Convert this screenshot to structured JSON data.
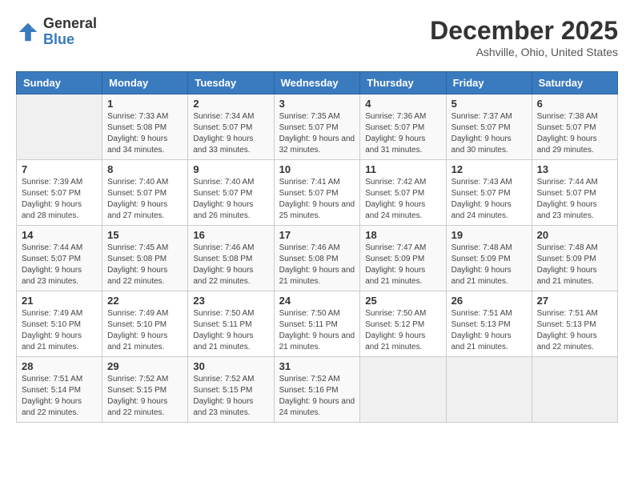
{
  "header": {
    "logo_general": "General",
    "logo_blue": "Blue",
    "month_title": "December 2025",
    "location": "Ashville, Ohio, United States"
  },
  "weekdays": [
    "Sunday",
    "Monday",
    "Tuesday",
    "Wednesday",
    "Thursday",
    "Friday",
    "Saturday"
  ],
  "weeks": [
    [
      {
        "day": "",
        "sunrise": "",
        "sunset": "",
        "daylight": ""
      },
      {
        "day": "1",
        "sunrise": "Sunrise: 7:33 AM",
        "sunset": "Sunset: 5:08 PM",
        "daylight": "Daylight: 9 hours and 34 minutes."
      },
      {
        "day": "2",
        "sunrise": "Sunrise: 7:34 AM",
        "sunset": "Sunset: 5:07 PM",
        "daylight": "Daylight: 9 hours and 33 minutes."
      },
      {
        "day": "3",
        "sunrise": "Sunrise: 7:35 AM",
        "sunset": "Sunset: 5:07 PM",
        "daylight": "Daylight: 9 hours and 32 minutes."
      },
      {
        "day": "4",
        "sunrise": "Sunrise: 7:36 AM",
        "sunset": "Sunset: 5:07 PM",
        "daylight": "Daylight: 9 hours and 31 minutes."
      },
      {
        "day": "5",
        "sunrise": "Sunrise: 7:37 AM",
        "sunset": "Sunset: 5:07 PM",
        "daylight": "Daylight: 9 hours and 30 minutes."
      },
      {
        "day": "6",
        "sunrise": "Sunrise: 7:38 AM",
        "sunset": "Sunset: 5:07 PM",
        "daylight": "Daylight: 9 hours and 29 minutes."
      }
    ],
    [
      {
        "day": "7",
        "sunrise": "Sunrise: 7:39 AM",
        "sunset": "Sunset: 5:07 PM",
        "daylight": "Daylight: 9 hours and 28 minutes."
      },
      {
        "day": "8",
        "sunrise": "Sunrise: 7:40 AM",
        "sunset": "Sunset: 5:07 PM",
        "daylight": "Daylight: 9 hours and 27 minutes."
      },
      {
        "day": "9",
        "sunrise": "Sunrise: 7:40 AM",
        "sunset": "Sunset: 5:07 PM",
        "daylight": "Daylight: 9 hours and 26 minutes."
      },
      {
        "day": "10",
        "sunrise": "Sunrise: 7:41 AM",
        "sunset": "Sunset: 5:07 PM",
        "daylight": "Daylight: 9 hours and 25 minutes."
      },
      {
        "day": "11",
        "sunrise": "Sunrise: 7:42 AM",
        "sunset": "Sunset: 5:07 PM",
        "daylight": "Daylight: 9 hours and 24 minutes."
      },
      {
        "day": "12",
        "sunrise": "Sunrise: 7:43 AM",
        "sunset": "Sunset: 5:07 PM",
        "daylight": "Daylight: 9 hours and 24 minutes."
      },
      {
        "day": "13",
        "sunrise": "Sunrise: 7:44 AM",
        "sunset": "Sunset: 5:07 PM",
        "daylight": "Daylight: 9 hours and 23 minutes."
      }
    ],
    [
      {
        "day": "14",
        "sunrise": "Sunrise: 7:44 AM",
        "sunset": "Sunset: 5:07 PM",
        "daylight": "Daylight: 9 hours and 23 minutes."
      },
      {
        "day": "15",
        "sunrise": "Sunrise: 7:45 AM",
        "sunset": "Sunset: 5:08 PM",
        "daylight": "Daylight: 9 hours and 22 minutes."
      },
      {
        "day": "16",
        "sunrise": "Sunrise: 7:46 AM",
        "sunset": "Sunset: 5:08 PM",
        "daylight": "Daylight: 9 hours and 22 minutes."
      },
      {
        "day": "17",
        "sunrise": "Sunrise: 7:46 AM",
        "sunset": "Sunset: 5:08 PM",
        "daylight": "Daylight: 9 hours and 21 minutes."
      },
      {
        "day": "18",
        "sunrise": "Sunrise: 7:47 AM",
        "sunset": "Sunset: 5:09 PM",
        "daylight": "Daylight: 9 hours and 21 minutes."
      },
      {
        "day": "19",
        "sunrise": "Sunrise: 7:48 AM",
        "sunset": "Sunset: 5:09 PM",
        "daylight": "Daylight: 9 hours and 21 minutes."
      },
      {
        "day": "20",
        "sunrise": "Sunrise: 7:48 AM",
        "sunset": "Sunset: 5:09 PM",
        "daylight": "Daylight: 9 hours and 21 minutes."
      }
    ],
    [
      {
        "day": "21",
        "sunrise": "Sunrise: 7:49 AM",
        "sunset": "Sunset: 5:10 PM",
        "daylight": "Daylight: 9 hours and 21 minutes."
      },
      {
        "day": "22",
        "sunrise": "Sunrise: 7:49 AM",
        "sunset": "Sunset: 5:10 PM",
        "daylight": "Daylight: 9 hours and 21 minutes."
      },
      {
        "day": "23",
        "sunrise": "Sunrise: 7:50 AM",
        "sunset": "Sunset: 5:11 PM",
        "daylight": "Daylight: 9 hours and 21 minutes."
      },
      {
        "day": "24",
        "sunrise": "Sunrise: 7:50 AM",
        "sunset": "Sunset: 5:11 PM",
        "daylight": "Daylight: 9 hours and 21 minutes."
      },
      {
        "day": "25",
        "sunrise": "Sunrise: 7:50 AM",
        "sunset": "Sunset: 5:12 PM",
        "daylight": "Daylight: 9 hours and 21 minutes."
      },
      {
        "day": "26",
        "sunrise": "Sunrise: 7:51 AM",
        "sunset": "Sunset: 5:13 PM",
        "daylight": "Daylight: 9 hours and 21 minutes."
      },
      {
        "day": "27",
        "sunrise": "Sunrise: 7:51 AM",
        "sunset": "Sunset: 5:13 PM",
        "daylight": "Daylight: 9 hours and 22 minutes."
      }
    ],
    [
      {
        "day": "28",
        "sunrise": "Sunrise: 7:51 AM",
        "sunset": "Sunset: 5:14 PM",
        "daylight": "Daylight: 9 hours and 22 minutes."
      },
      {
        "day": "29",
        "sunrise": "Sunrise: 7:52 AM",
        "sunset": "Sunset: 5:15 PM",
        "daylight": "Daylight: 9 hours and 22 minutes."
      },
      {
        "day": "30",
        "sunrise": "Sunrise: 7:52 AM",
        "sunset": "Sunset: 5:15 PM",
        "daylight": "Daylight: 9 hours and 23 minutes."
      },
      {
        "day": "31",
        "sunrise": "Sunrise: 7:52 AM",
        "sunset": "Sunset: 5:16 PM",
        "daylight": "Daylight: 9 hours and 24 minutes."
      },
      {
        "day": "",
        "sunrise": "",
        "sunset": "",
        "daylight": ""
      },
      {
        "day": "",
        "sunrise": "",
        "sunset": "",
        "daylight": ""
      },
      {
        "day": "",
        "sunrise": "",
        "sunset": "",
        "daylight": ""
      }
    ]
  ]
}
